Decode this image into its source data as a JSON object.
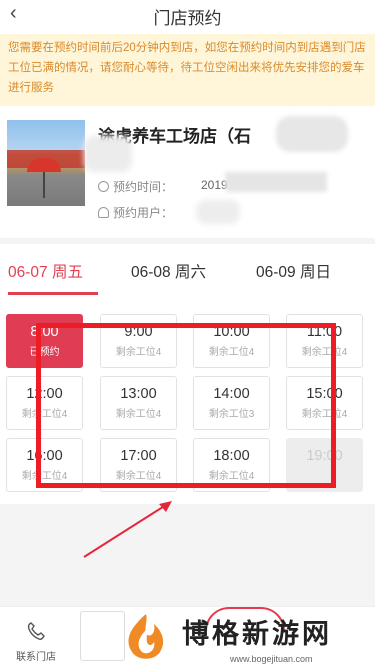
{
  "header": {
    "back_icon": "‹",
    "title": "门店预约"
  },
  "notice": {
    "text": "您需要在预约时间前后20分钟内到店，如您在预约时间内到店遇到门店工位已满的情况，请您耐心等待，待工位空闲出来将优先安排您的爱车进行服务"
  },
  "store": {
    "name": "途虎养车工场店（石",
    "time_label": "预约时间：",
    "time_value": "2019",
    "user_label": "预约用户：",
    "user_value": "李"
  },
  "dates": [
    {
      "label": "06-07 周五",
      "active": true
    },
    {
      "label": "06-08 周六",
      "active": false
    },
    {
      "label": "06-09 周日",
      "active": false
    }
  ],
  "slots": [
    {
      "time": "8:00",
      "status": "已预约",
      "state": "selected"
    },
    {
      "time": "9:00",
      "status": "剩余工位4",
      "state": "normal"
    },
    {
      "time": "10:00",
      "status": "剩余工位4",
      "state": "normal"
    },
    {
      "time": "11:00",
      "status": "剩余工位4",
      "state": "normal"
    },
    {
      "time": "12:00",
      "status": "剩余工位4",
      "state": "normal"
    },
    {
      "time": "13:00",
      "status": "剩余工位4",
      "state": "normal"
    },
    {
      "time": "14:00",
      "status": "剩余工位3",
      "state": "normal"
    },
    {
      "time": "15:00",
      "status": "剩余工位4",
      "state": "normal"
    },
    {
      "time": "16:00",
      "status": "剩余工位4",
      "state": "normal"
    },
    {
      "time": "17:00",
      "status": "剩余工位4",
      "state": "normal"
    },
    {
      "time": "18:00",
      "status": "剩余工位4",
      "state": "normal"
    },
    {
      "time": "19:00",
      "status": "",
      "state": "disabled"
    }
  ],
  "bottom": {
    "contact_label": "联系门店"
  },
  "watermark": {
    "text": "博格新游网",
    "url": "www.bogejituan.com"
  },
  "colors": {
    "accent": "#e33f53",
    "notice_bg": "#fff6d9",
    "notice_text": "#d98a2b",
    "annotation": "#ee1c25"
  },
  "icons": [
    "back-icon",
    "clock-icon",
    "user-icon",
    "phone-icon",
    "arrow-annotation"
  ]
}
